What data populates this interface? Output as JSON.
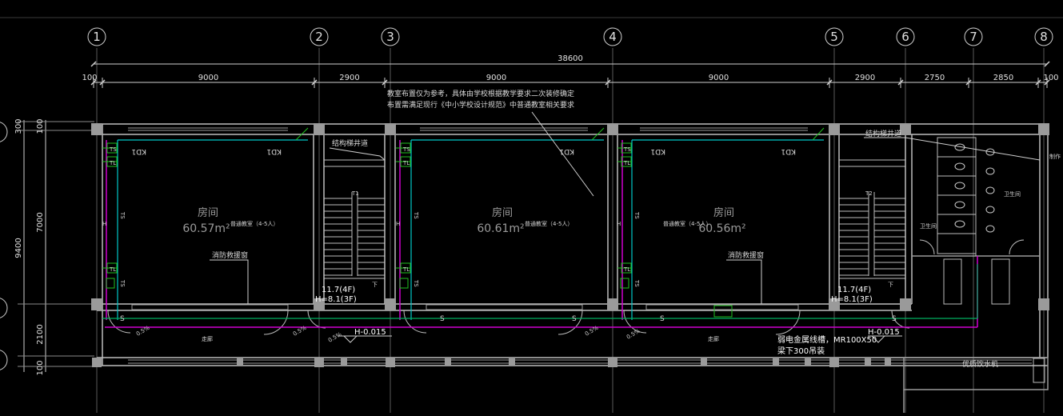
{
  "axes": [
    "1",
    "2",
    "3",
    "4",
    "5",
    "6",
    "7",
    "8"
  ],
  "total_dimension": "38600",
  "spans": [
    "100",
    "9000",
    "2900",
    "9000",
    "9000",
    "2900",
    "2750",
    "2850",
    "100"
  ],
  "vertical_dims": {
    "total": "9400",
    "parts": [
      "300",
      "7000",
      "2100"
    ],
    "inner": [
      "100",
      "100"
    ]
  },
  "note_lines": [
    "教室布置仅为参考，具体由学校根据教学要求二次装修确定",
    "布置需满足现行《中小学校设计规范》中普通教室相关要求"
  ],
  "rooms": [
    {
      "name": "房间",
      "area": "60.57m²",
      "note": "普通教室（4-5人）"
    },
    {
      "name": "房间",
      "area": "60.61m²",
      "note": "普通教室（4-5人）"
    },
    {
      "name": "房间",
      "area": "60.56m²",
      "note": "普通教室（4-5人）"
    }
  ],
  "labels": {
    "struct_shaft": "结构梯井道",
    "fire_window": "消防救援窗",
    "kd": "KD1",
    "stair1": "T1",
    "stair2": "T2",
    "down": "下",
    "level_1a": "11.7(4F)",
    "level_1b": "H=8.1(3F)",
    "level_2a": "11.7(4F)",
    "level_2b": "H=8.1(3F)",
    "h_level1": "H-0.015",
    "h_level2": "H-0.015",
    "slope": "0.5%",
    "cable1": "弱电金属线槽，MR100X50",
    "cable2": "梁下300吊装",
    "water": "优质饮水机",
    "corridor": "走廊",
    "restroom": "卫生间",
    "pipe_ts": "TS",
    "pipe_tl": "TL",
    "pipe_h": "H",
    "side_mark": "制作"
  }
}
